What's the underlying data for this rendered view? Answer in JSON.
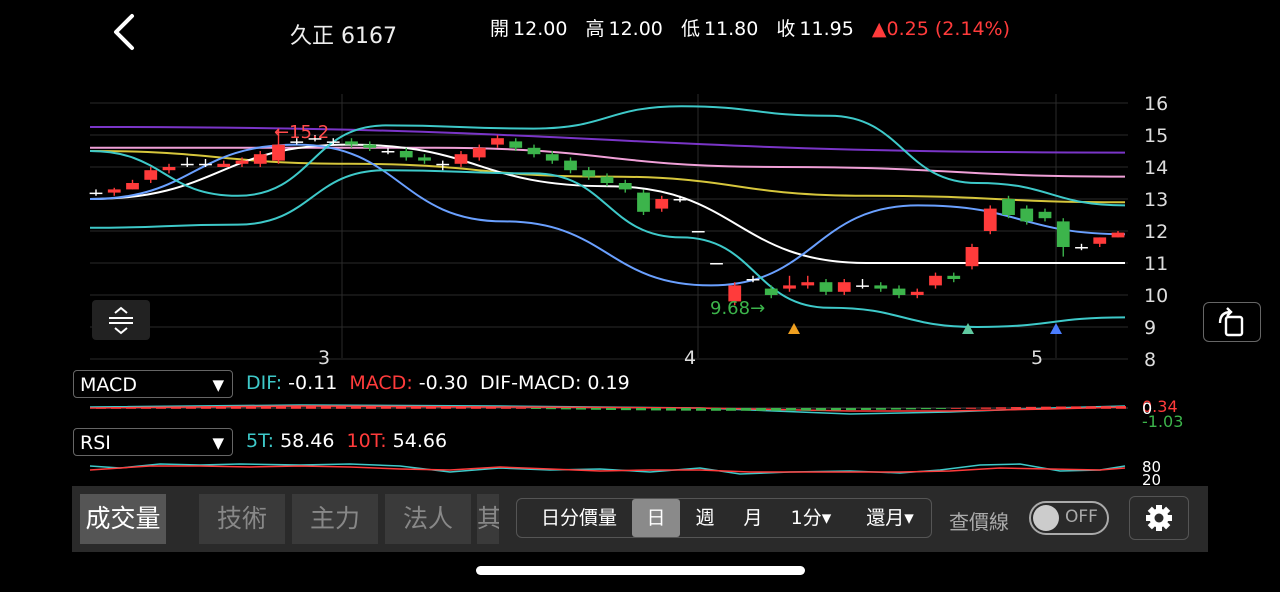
{
  "header": {
    "stock_name": "久正",
    "stock_code": "6167",
    "quote": {
      "open_label": "開",
      "open": "12.00",
      "high_label": "高",
      "high": "12.00",
      "low_label": "低",
      "low": "11.80",
      "close_label": "收",
      "close": "11.95",
      "change": "▲0.25 (2.14%)"
    }
  },
  "colors": {
    "up": "#ff3b3b",
    "down": "#3cb44b",
    "accent": "#3ec9c9"
  },
  "main_chart": {
    "y_ticks": [
      "16",
      "15",
      "14",
      "13",
      "12",
      "11",
      "10",
      "9",
      "8"
    ],
    "x_ticks": [
      "3",
      "4",
      "5"
    ],
    "max_annotation": "←15.2",
    "min_annotation": "9.68→"
  },
  "chart_data": {
    "type": "candlestick",
    "ylim": [
      8,
      16.5
    ],
    "y_ticks": [
      16,
      15,
      14,
      13,
      12,
      11,
      10,
      9,
      8
    ],
    "x_ticks": [
      "3",
      "4",
      "5"
    ],
    "candles": [
      [
        13.2,
        13.2,
        13.3,
        13.1
      ],
      [
        13.2,
        13.3,
        13.35,
        13.1
      ],
      [
        13.3,
        13.5,
        13.6,
        13.3
      ],
      [
        13.6,
        13.9,
        14.0,
        13.5
      ],
      [
        13.9,
        14.0,
        14.1,
        13.8
      ],
      [
        14.1,
        14.1,
        14.3,
        14.0
      ],
      [
        14.1,
        14.1,
        14.25,
        14.0
      ],
      [
        14.0,
        14.1,
        14.2,
        14.0
      ],
      [
        14.1,
        14.2,
        14.3,
        14.0
      ],
      [
        14.1,
        14.4,
        14.5,
        14.0
      ],
      [
        14.2,
        14.7,
        15.2,
        14.1
      ],
      [
        14.8,
        14.8,
        14.9,
        14.7
      ],
      [
        14.9,
        14.9,
        15.0,
        14.8
      ],
      [
        14.8,
        14.8,
        14.9,
        14.7
      ],
      [
        14.8,
        14.7,
        14.9,
        14.6
      ],
      [
        14.7,
        14.6,
        14.8,
        14.5
      ],
      [
        14.5,
        14.5,
        14.6,
        14.4
      ],
      [
        14.5,
        14.3,
        14.6,
        14.2
      ],
      [
        14.3,
        14.2,
        14.4,
        14.1
      ],
      [
        14.1,
        14.1,
        14.2,
        13.9
      ],
      [
        14.1,
        14.4,
        14.5,
        14.0
      ],
      [
        14.3,
        14.6,
        14.7,
        14.2
      ],
      [
        14.7,
        14.9,
        15.0,
        14.6
      ],
      [
        14.8,
        14.6,
        14.9,
        14.5
      ],
      [
        14.6,
        14.4,
        14.7,
        14.3
      ],
      [
        14.4,
        14.2,
        14.5,
        14.1
      ],
      [
        14.2,
        13.9,
        14.3,
        13.8
      ],
      [
        13.9,
        13.7,
        14.0,
        13.6
      ],
      [
        13.7,
        13.5,
        13.8,
        13.4
      ],
      [
        13.5,
        13.3,
        13.6,
        13.2
      ],
      [
        13.2,
        12.6,
        13.3,
        12.5
      ],
      [
        12.7,
        13.0,
        13.1,
        12.6
      ],
      [
        13.0,
        13.0,
        13.1,
        12.9
      ],
      [
        12.0,
        12.0,
        12.0,
        12.0
      ],
      [
        11.0,
        11.0,
        11.0,
        11.0
      ],
      [
        9.8,
        10.3,
        10.4,
        9.68
      ],
      [
        10.5,
        10.5,
        10.6,
        10.4
      ],
      [
        10.2,
        10.0,
        10.3,
        9.9
      ],
      [
        10.2,
        10.3,
        10.6,
        10.1
      ],
      [
        10.3,
        10.4,
        10.6,
        10.2
      ],
      [
        10.4,
        10.1,
        10.5,
        10.0
      ],
      [
        10.1,
        10.4,
        10.5,
        10.0
      ],
      [
        10.3,
        10.3,
        10.5,
        10.2
      ],
      [
        10.3,
        10.2,
        10.4,
        10.1
      ],
      [
        10.2,
        10.0,
        10.3,
        9.9
      ],
      [
        10.0,
        10.1,
        10.2,
        9.9
      ],
      [
        10.3,
        10.6,
        10.7,
        10.2
      ],
      [
        10.6,
        10.5,
        10.7,
        10.4
      ],
      [
        10.9,
        11.5,
        11.6,
        10.8
      ],
      [
        12.0,
        12.7,
        12.8,
        11.9
      ],
      [
        13.0,
        12.5,
        13.1,
        12.4
      ],
      [
        12.7,
        12.3,
        12.8,
        12.2
      ],
      [
        12.6,
        12.4,
        12.7,
        12.3
      ],
      [
        12.3,
        11.5,
        12.4,
        11.2
      ],
      [
        11.5,
        11.5,
        11.6,
        11.4
      ],
      [
        11.6,
        11.8,
        11.8,
        11.5
      ],
      [
        11.8,
        11.95,
        12.0,
        11.8
      ]
    ],
    "moving_averages": [
      {
        "color": "#7a35c8",
        "values": [
          15.25,
          14.45
        ]
      },
      {
        "color": "#f0a0d8",
        "values": [
          14.6,
          14.6,
          14.0,
          13.7
        ]
      },
      {
        "color": "#d6c63c",
        "values": [
          14.5,
          14.1,
          13.7,
          13.1,
          12.9
        ]
      },
      {
        "color": "#ffffff",
        "values": [
          13.0,
          14.7,
          13.4,
          11.0,
          11.0
        ]
      },
      {
        "color": "#6aa0ff",
        "values": [
          13.0,
          14.7,
          12.3,
          10.3,
          12.8,
          11.9
        ]
      },
      {
        "color": "#3ec9c9",
        "values": [
          12.1,
          12.2,
          13.9,
          13.8,
          11.8,
          9.6,
          9.0,
          9.3
        ]
      },
      {
        "color": "#3ec9c9",
        "values": [
          14.5,
          13.1,
          15.3,
          15.2,
          15.9,
          15.6,
          13.5,
          12.8
        ]
      }
    ]
  },
  "macd": {
    "select_label": "MACD",
    "dif_label": "DIF:",
    "dif_value": "-0.11",
    "macd_label": "MACD:",
    "macd_value": "-0.30",
    "osc_label": "DIF-MACD:",
    "osc_value": "0.19",
    "axis_top": "0.34",
    "axis_mid": "0",
    "axis_bottom": "-1.03"
  },
  "rsi": {
    "select_label": "RSI",
    "t5_label": "5T:",
    "t5_value": "58.46",
    "t10_label": "10T:",
    "t10_value": "54.66",
    "axis_top": "80",
    "axis_bottom": "20"
  },
  "bottom_tabs": [
    {
      "label": "成交量"
    },
    {
      "label": "技術"
    },
    {
      "label": "主力"
    },
    {
      "label": "法人"
    },
    {
      "label": "其"
    }
  ],
  "periods": {
    "intraday": "日分價量",
    "day": "日",
    "week": "週",
    "month": "月",
    "minute": "1分▾",
    "restore": "還月▾"
  },
  "price_ref": {
    "label": "查價線",
    "toggle": "OFF"
  }
}
